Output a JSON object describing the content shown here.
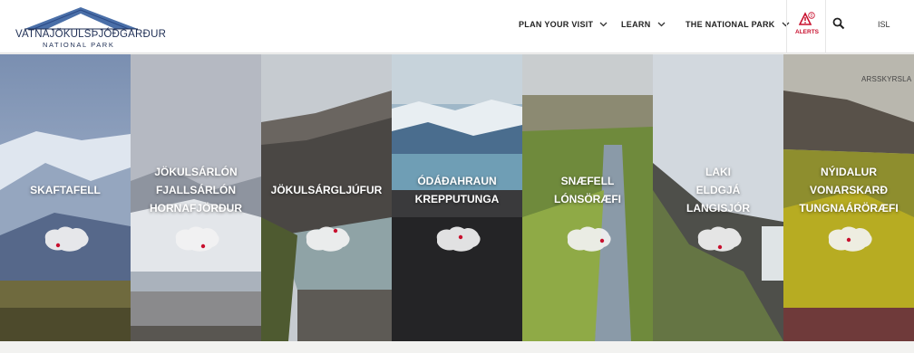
{
  "header": {
    "logo_title": "VATNAJÖKULSÞJÓÐGARÐUR",
    "logo_subtitle": "NATIONAL PARK",
    "nav": [
      {
        "label": "PLAN YOUR VISIT"
      },
      {
        "label": "LEARN"
      },
      {
        "label": "THE NATIONAL PARK"
      }
    ],
    "alerts_label": "ALERTS",
    "alerts_count": "0",
    "language": "ISL"
  },
  "annual_report_link": "ARSSKYRSLA",
  "panels": [
    {
      "lines": [
        "SKAFTAFELL"
      ],
      "icon": "iceland-map-icon"
    },
    {
      "lines": [
        "JÖKULSÁRLÓN",
        "FJALLSÁRLÓN",
        "HORNAFJÖRÐUR"
      ],
      "icon": "iceland-map-icon"
    },
    {
      "lines": [
        "JÖKULSÁRGLJÚFUR"
      ],
      "icon": "iceland-map-icon"
    },
    {
      "lines": [
        "ÓDÁÐAHRAUN",
        "KREPPUTUNGA"
      ],
      "icon": "iceland-map-icon"
    },
    {
      "lines": [
        "SNÆFELL",
        "LÓNSÖRÆFI"
      ],
      "icon": "iceland-map-icon"
    },
    {
      "lines": [
        "LAKI",
        "ELDGJÁ",
        "LANGISJÓR"
      ],
      "icon": "iceland-map-icon"
    },
    {
      "lines": [
        "NÝIDALUR",
        "VONARSKARÐ",
        "TUNGNAÁRÖRÆFI"
      ],
      "icon": "iceland-map-icon"
    }
  ],
  "colors": {
    "brand_navy": "#1f2f55",
    "alert_red": "#c8102e"
  }
}
